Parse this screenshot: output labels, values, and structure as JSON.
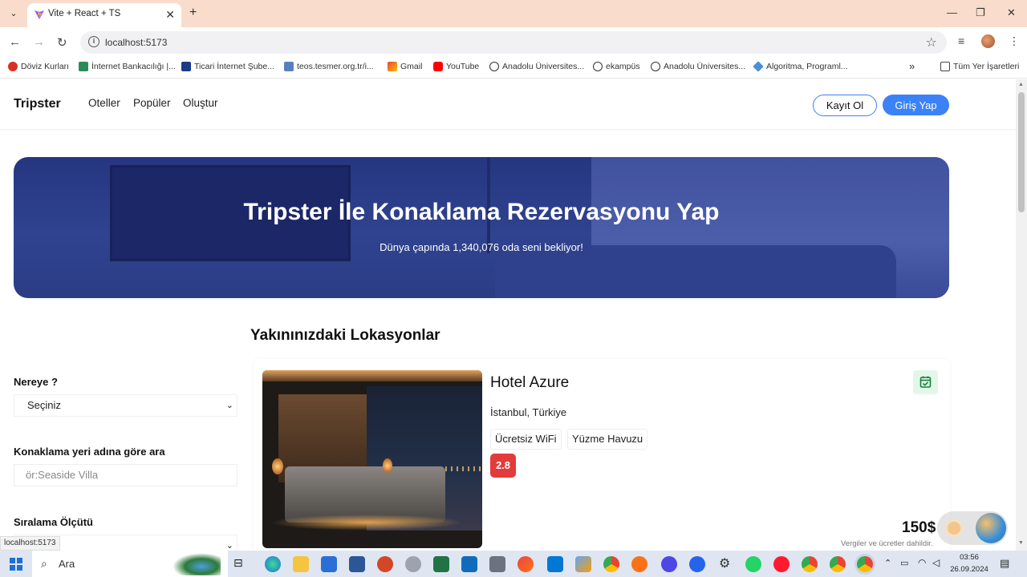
{
  "browser": {
    "tab_title": "Vite + React + TS",
    "url": "localhost:5173",
    "status_url": "localhost:5173",
    "bookmarks": [
      "Döviz Kurları",
      "İnternet Bankacılığı |...",
      "Ticari İnternet Şube...",
      "teos.tesmer.org.tr/i...",
      "Gmail",
      "YouTube",
      "Anadolu Üniversites...",
      "ekampüs",
      "Anadolu Üniversites...",
      "Algoritma, Programl..."
    ],
    "all_bookmarks": "Tüm Yer İşaretleri",
    "more_bookmarks": "»"
  },
  "site": {
    "brand": "Tripster",
    "nav": [
      "Oteller",
      "Popüler",
      "Oluştur"
    ],
    "register": "Kayıt Ol",
    "login": "Giriş Yap"
  },
  "hero": {
    "title": "Tripster İle Konaklama Rezervasyonu Yap",
    "subtitle": "Dünya çapında 1,340,076 oda seni bekliyor!"
  },
  "filters": {
    "where_label": "Nereye ?",
    "where_value": "Seçiniz",
    "name_label": "Konaklama yeri adına göre ara",
    "name_placeholder": "ör:Seaside Villa",
    "sort_label": "Sıralama Ölçütü"
  },
  "section": {
    "title": "Yakınınızdaki Lokasyonlar"
  },
  "hotel": {
    "name": "Hotel Azure",
    "location": "İstanbul, Türkiye",
    "amenities": [
      "Ücretsiz WiFi",
      "Yüzme Havuzu"
    ],
    "rating": "2.8",
    "price": "150$",
    "price_note": "Vergiler ve ücretler dahildir."
  },
  "taskbar": {
    "search": "Ara",
    "time": "03:56",
    "date": "26.09.2024"
  },
  "colors": {
    "accent": "#3b82f6",
    "rating": "#e33b3b",
    "tabbar": "#f9dccb"
  }
}
